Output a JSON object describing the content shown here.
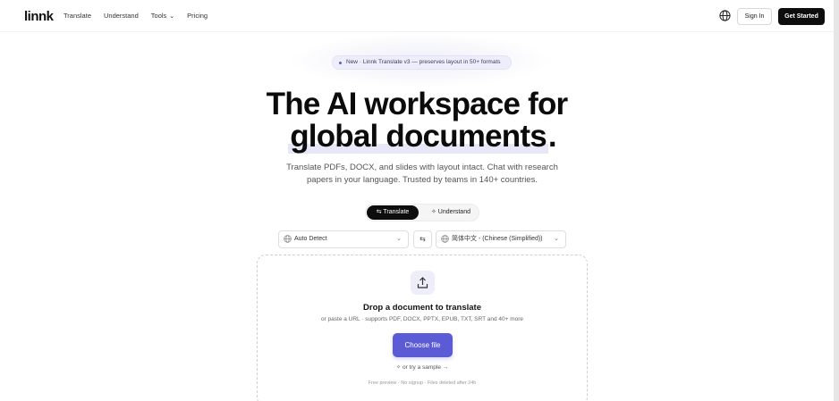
{
  "header": {
    "logo": "linnk",
    "nav": [
      {
        "label": "Translate"
      },
      {
        "label": "Understand"
      },
      {
        "label": "Tools"
      },
      {
        "label": "Pricing"
      }
    ],
    "icons": {
      "language": "globe-icon",
      "tools_dropdown": "chevron-down-icon"
    },
    "sign_in": "Sign In",
    "get_started": "Get Started"
  },
  "badge": {
    "text": "New · Linnk Translate v3 — preserves layout in 50+ formats"
  },
  "hero": {
    "line1": "The AI workspace for",
    "line2_highlight": "global documents",
    "line2_end": ".",
    "subtitle_line1": "Translate PDFs, DOCX, and slides with layout intact. Chat with research",
    "subtitle_line2": "papers in your language. Trusted by teams in 140+ countries."
  },
  "mode_toggle": {
    "active": "Translate",
    "other": "Understand",
    "active_icon": "swap-icon",
    "other_icon": "sparkle-icon"
  },
  "languages": {
    "source": "Auto Detect",
    "target": "简体中文 - (Chinese (Simplified))",
    "swap_icon": "swap-arrows-icon"
  },
  "dropzone": {
    "icon": "upload-icon",
    "title": "Drop a document to translate",
    "subtitle": "or paste a URL · supports PDF, DOCX, PPTX, EPUB, TXT, SRT and 40+ more",
    "button": "Choose file",
    "sample": "or try a sample →",
    "fine_print": "Free preview · No signup · Files deleted after 24h"
  },
  "colors": {
    "accent": "#5b5bd6",
    "dark": "#0d0d0d",
    "badge_bg": "#eeeefb"
  }
}
